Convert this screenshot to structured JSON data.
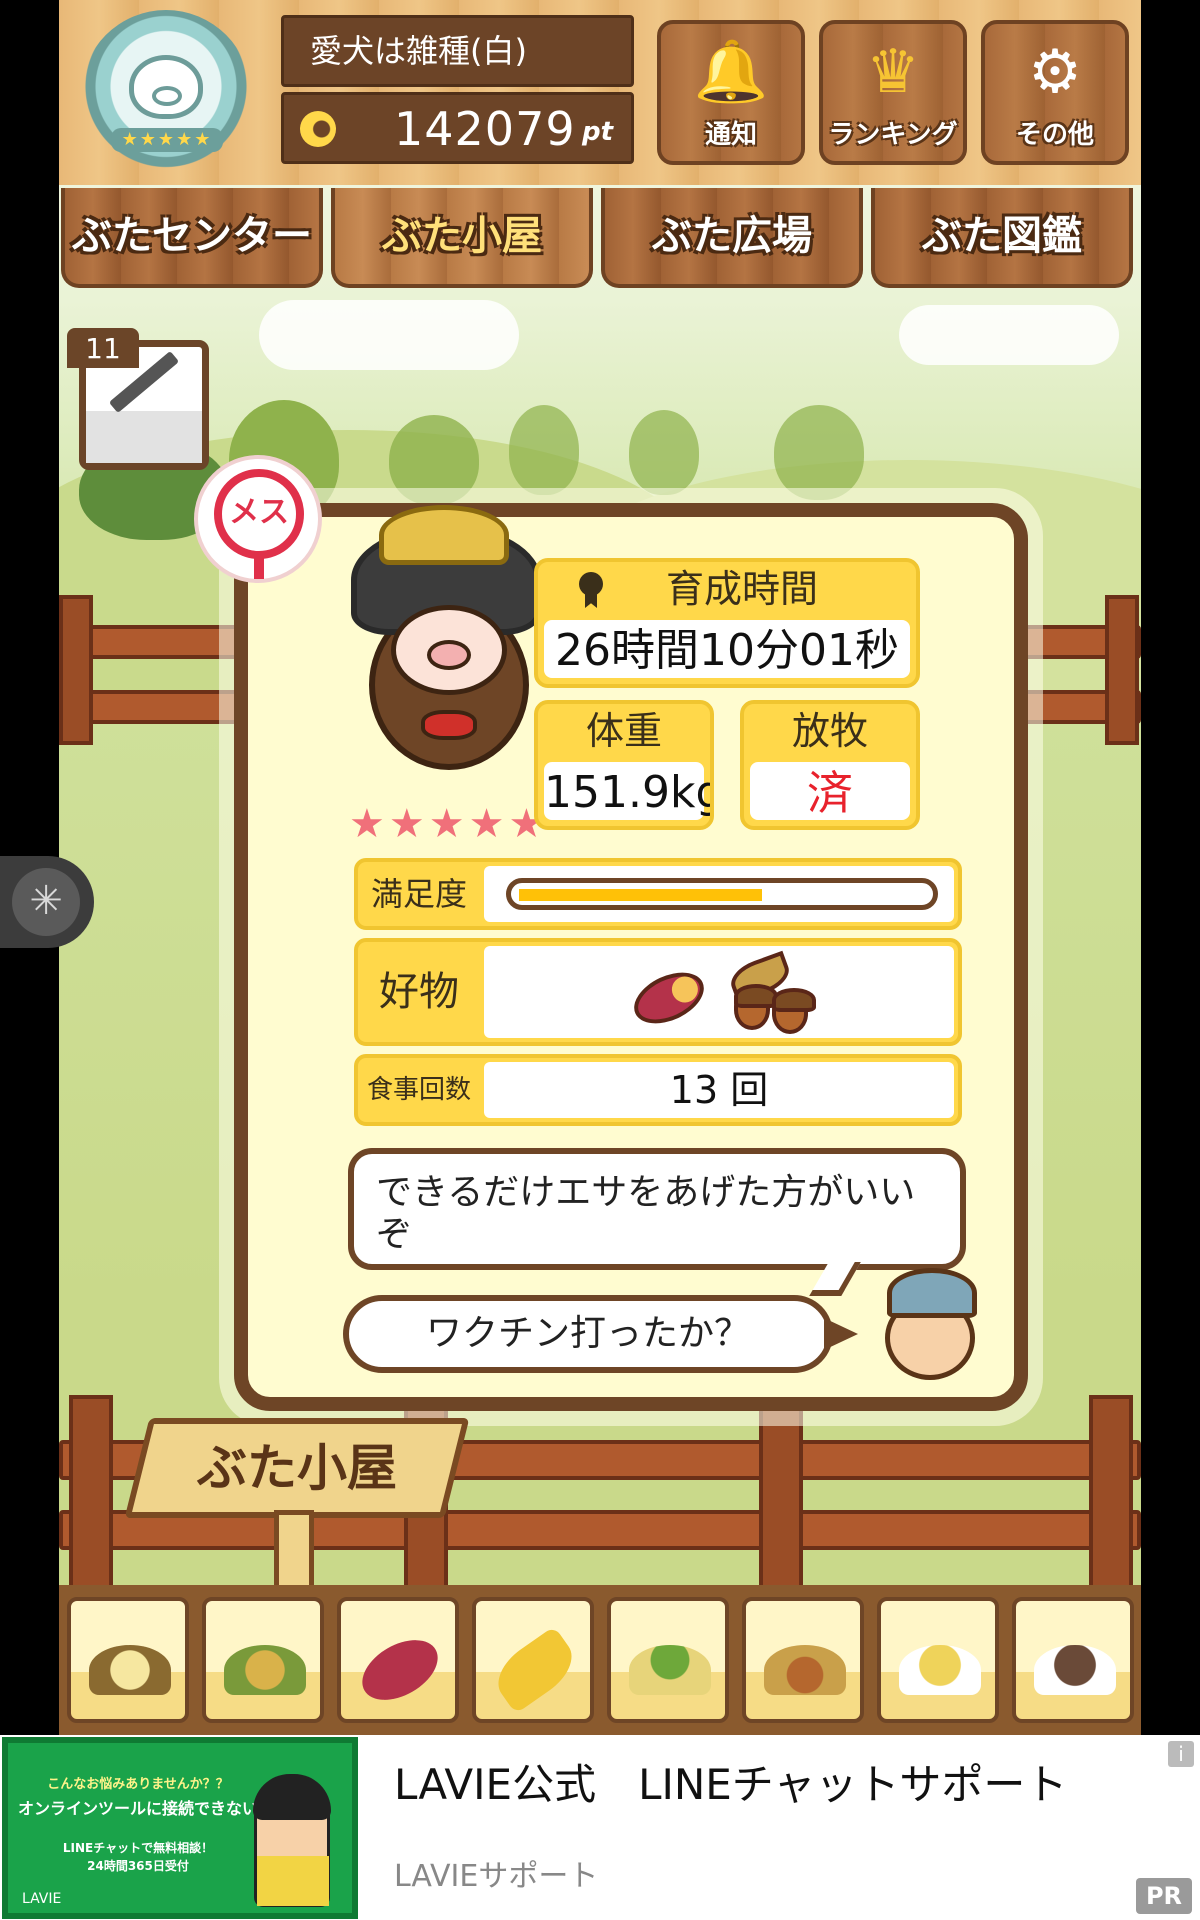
{
  "header": {
    "pig_name": "愛犬は雑種(白)",
    "points_value": "142079",
    "points_unit": "pt",
    "buttons": [
      {
        "label": "通知",
        "icon": "bell-icon"
      },
      {
        "label": "ランキング",
        "icon": "crown-icon"
      },
      {
        "label": "その他",
        "icon": "gear-icon"
      }
    ]
  },
  "nav": {
    "tabs": [
      {
        "label": "ぶたセンター",
        "active": false
      },
      {
        "label": "ぶた小屋",
        "active": true
      },
      {
        "label": "ぶた広場",
        "active": false
      },
      {
        "label": "ぶた図鑑",
        "active": false
      }
    ]
  },
  "vaccine": {
    "count": "11",
    "icon": "syringe-icon"
  },
  "pig": {
    "sex_label": "メス",
    "rarity": "★★★★★",
    "rarity_count": 5
  },
  "stats": {
    "raising_time_label": "育成時間",
    "raising_time_value": "26時間10分01秒",
    "weight_label": "体重",
    "weight_value": "151.9kg",
    "grazing_label": "放牧",
    "grazing_value": "済"
  },
  "satisfaction": {
    "label": "満足度",
    "level": 0.6
  },
  "favorites": {
    "label": "好物",
    "items": [
      "sweet-potato-icon",
      "acorn-icon"
    ]
  },
  "meals": {
    "label": "食事回数",
    "value": "13 回"
  },
  "speech": {
    "advice": "できるだけエサをあげた方がいいぞ",
    "question": "ワクチン打ったか？"
  },
  "sign": {
    "label": "ぶた小屋"
  },
  "food_bar": {
    "items": [
      "grain-mix-icon",
      "mixed-beans-icon",
      "sweet-potato-icon",
      "corn-icon",
      "vegetables-icon",
      "acorn-icon",
      "soybeans-plate-icon",
      "truffle-plate-icon"
    ]
  },
  "ad": {
    "image_line1": "こんなお悩みありませんか？？",
    "image_line2": "オンラインツールに接続できない",
    "image_line3": "LINEチャットで無料相談！",
    "image_line4": "24時間365日受付",
    "image_brand": "LAVIE",
    "title": "LAVIE公式　LINEチャットサポート",
    "source": "LAVIEサポート",
    "info": "i",
    "pr": "PR"
  },
  "colors": {
    "wood": "#6e4526",
    "card_bg": "#fffcd0",
    "stat_yellow": "#ffd84a",
    "female_red": "#e0304a",
    "meter_fill": "#ffc107",
    "ad_green": "#1aa34a"
  }
}
